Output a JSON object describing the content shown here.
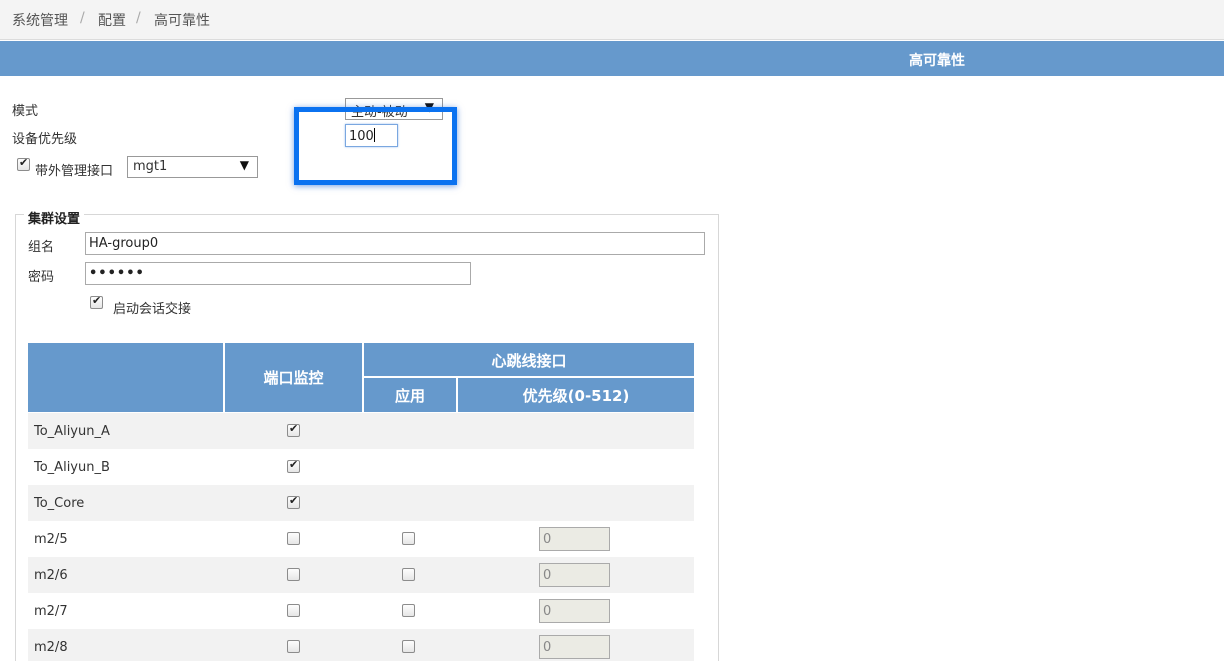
{
  "breadcrumb": {
    "items": [
      "系统管理",
      "配置",
      "高可靠性"
    ],
    "separator": "/"
  },
  "page_title": "高可靠性",
  "form": {
    "mode_label": "模式",
    "mode_value": "主动-被动",
    "priority_label": "设备优先级",
    "priority_value": "100",
    "oob_label": "带外管理接口",
    "oob_checked": true,
    "oob_value": "mgt1"
  },
  "cluster": {
    "legend": "集群设置",
    "group_name_label": "组名",
    "group_name_value": "HA-group0",
    "password_label": "密码",
    "password_value": "••••••",
    "session_sync_label": "启动会话交接",
    "session_sync_checked": true
  },
  "table": {
    "col_port_monitor": "端口监控",
    "col_heartbeat": "心跳线接口",
    "col_apply": "应用",
    "col_priority": "优先级(0-512)",
    "rows": [
      {
        "name": "To_Aliyun_A",
        "monitor": true,
        "apply": null,
        "priority": null
      },
      {
        "name": "To_Aliyun_B",
        "monitor": true,
        "apply": null,
        "priority": null
      },
      {
        "name": "To_Core",
        "monitor": true,
        "apply": null,
        "priority": null
      },
      {
        "name": "m2/5",
        "monitor": false,
        "apply": false,
        "priority": "0"
      },
      {
        "name": "m2/6",
        "monitor": false,
        "apply": false,
        "priority": "0"
      },
      {
        "name": "m2/7",
        "monitor": false,
        "apply": false,
        "priority": "0"
      },
      {
        "name": "m2/8",
        "monitor": false,
        "apply": false,
        "priority": "0"
      }
    ]
  },
  "colors": {
    "header_blue": "#6699cc",
    "highlight_blue": "#0b72f0"
  }
}
